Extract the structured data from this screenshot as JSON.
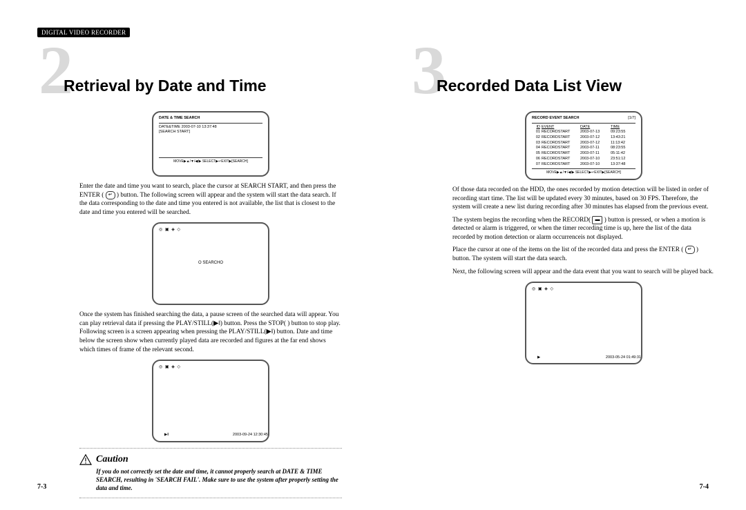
{
  "header_tab": "DIGITAL VIDEO RECORDER",
  "left": {
    "big_num": "2",
    "title": "Retrieval by Date and Time",
    "screen1": {
      "title": "DATE & TIME SEARCH",
      "line1": "DATE&TIME  2003-07-10  13:37:48",
      "line2": "[SEARCH START]",
      "footer": "MOVE▶▲/▼/◀/▶ SELECT▶↵EXIT▶[SEARCH]"
    },
    "para1a": "Enter the date and time you want to search, place the cursor at SEARCH START, and then press the ENTER (",
    "para1b": ") button. The following screen will appear and the system will start the data search. If the data corresponding to the date and time you entered is not available, the list that is closest to the date and time you entered will be searched.",
    "screen2": {
      "icons": "◎ ▣ ◈ ◇",
      "center": "O  SEARCHO"
    },
    "para2a": "Once the system has finished searching the data, a pause screen of the searched data will appear. You can play retrieval data if pressing the PLAY/STILL(▶‖) button. Press the STOP(  ) button to stop play. Following screen is a screen appearing when pressing the PLAY/STILL(▶‖) button. Date and time below the screen show when currently played data are recorded and figures at the far end shows which times of frame of the relevant second.",
    "screen3": {
      "icons": "◎ ▣ ◈ ◇",
      "play": "▶‖",
      "datetime": "2003-09-24 12:30:45"
    },
    "caution_head": "Caution",
    "caution_body": "If you do not correctly set the date and time, it cannot properly search at DATE & TIME SEARCH, resulting in 'SEARCH FAIL'. Make sure to use the system after properly setting the data and time.",
    "page_num": "7-3"
  },
  "right": {
    "big_num": "3",
    "title": "Recorded Data List View",
    "screen1": {
      "title": "RECORD EVENT SEARCH",
      "pager": "[1/7]",
      "head_id": "ID",
      "head_event": "EVENT",
      "head_date": "DATE",
      "head_time": "TIME",
      "rows": [
        {
          "id": "01",
          "ev": "RECORDSTART",
          "date": "2003-07-13",
          "time": "09:23:55"
        },
        {
          "id": "02",
          "ev": "RECORDSTART",
          "date": "2003-07-12",
          "time": "13:43:21"
        },
        {
          "id": "03",
          "ev": "RECORDSTART",
          "date": "2003-07-12",
          "time": "11:13:42"
        },
        {
          "id": "04",
          "ev": "RECORDSTART",
          "date": "2003-07-11",
          "time": "08:23:55"
        },
        {
          "id": "05",
          "ev": "RECORDSTART",
          "date": "2003-07-11",
          "time": "05:11:42"
        },
        {
          "id": "06",
          "ev": "RECORDSTART",
          "date": "2003-07-10",
          "time": "23:51:12"
        },
        {
          "id": "07",
          "ev": "RECORDSTART",
          "date": "2003-07-10",
          "time": "13:37:48"
        }
      ],
      "footer": "MOVE▶▲/▼/◀/▶ SELECT▶↵EXIT▶[SEARCH]"
    },
    "para1": "Of those data recorded on the HDD, the ones recorded by motion detection will be listed in order of recording start time. The list will be updated every 30 minutes, based on 30 FPS. Therefore, the system will create a new list during recording after 30 minutes has elapsed from the previous event.",
    "para2a": "The system begins the recording when the RECORD(",
    "para2b": ") button is pressed, or when a motion is detected or alarm is triggered, or when the timer recording time is up, here the list of the data recorded by motion detection or alarm occurrenceis not displayed.",
    "para3a": "Place the cursor at one of the items on the list of the recorded data and press the ENTER (",
    "para3b": ") button. The system will start the data search.",
    "para4": "Next, the following screen will appear and the data event that you want to search will be played back.",
    "screen2": {
      "icons": "◎ ▣ ◈ ◇",
      "play": "▶",
      "datetime": "2003-05-24  01:49:31"
    },
    "page_num": "7-4"
  },
  "icons": {
    "enter": "↵",
    "rec": "▬"
  }
}
